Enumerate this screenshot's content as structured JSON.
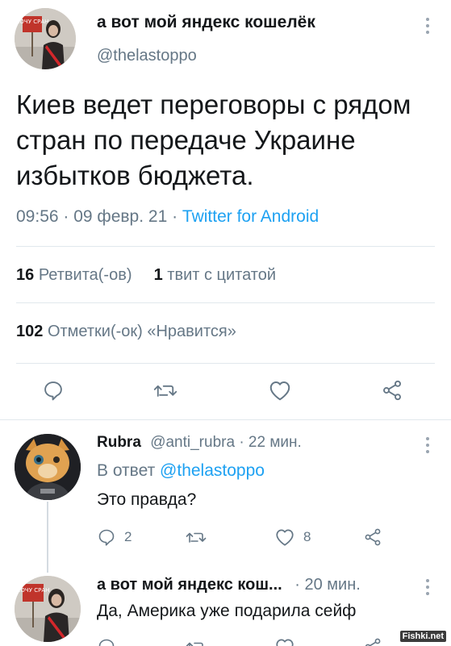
{
  "main_tweet": {
    "display_name": "а вот мой яндекс кошелёк",
    "handle": "@thelastoppo",
    "avatar_sign_text": "ХОЧУ СРАН",
    "text": "Киев ведет переговоры с рядом стран по передаче Украине избытков бюджета.",
    "time": "09:56",
    "date": "09 февр. 21",
    "source": "Twitter for Android",
    "retweets_count": "16",
    "retweets_label": "Ретвита(-ов)",
    "quotes_count": "1",
    "quotes_label": "твит с цитатой",
    "likes_count": "102",
    "likes_label": "Отметки(-ок) «Нравится»"
  },
  "reply_1": {
    "display_name": "Rubra",
    "handle": "@anti_rubra",
    "time": "22 мин.",
    "reply_prefix": "В ответ",
    "reply_to": "@thelastoppo",
    "text": "Это правда?",
    "reply_count": "2",
    "like_count": "8"
  },
  "reply_2": {
    "display_name": "а вот мой яндекс кош...",
    "time": "20 мин.",
    "text": "Да, Америка уже подарила сейф"
  },
  "watermark": "Fishki.net",
  "colors": {
    "text": "#14171a",
    "secondary": "#657786",
    "link": "#1da1f2",
    "divider": "#e1e8ed",
    "icon": "#657786"
  },
  "icons": [
    "more-icon",
    "reply-icon",
    "retweet-icon",
    "like-icon",
    "share-icon"
  ]
}
